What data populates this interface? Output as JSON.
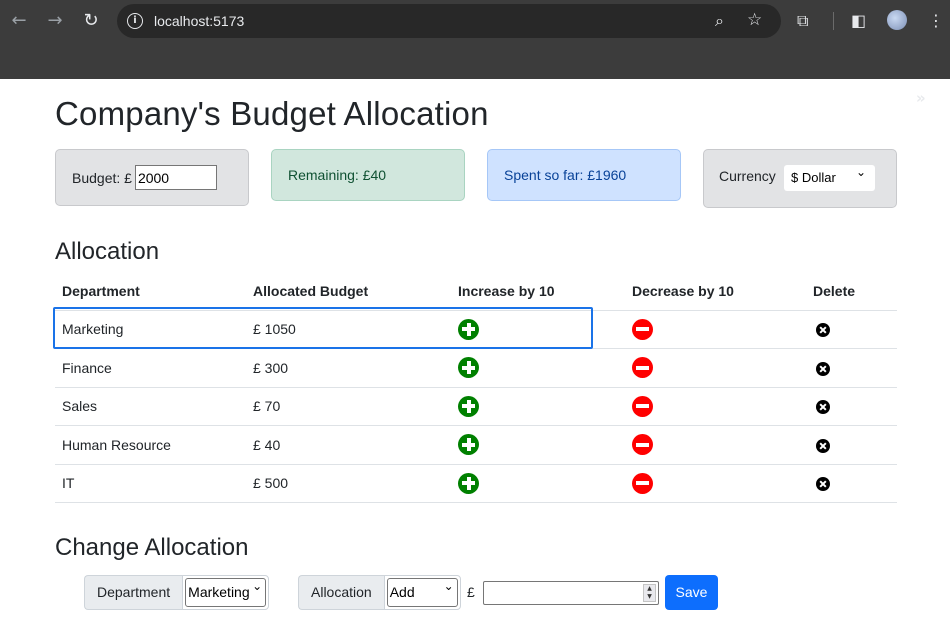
{
  "browser": {
    "url": "localhost:5173",
    "back_icon": "arrow-left-icon",
    "forward_icon": "arrow-right-icon",
    "reload_icon": "reload-icon"
  },
  "header": {
    "title": "Company's Budget Allocation"
  },
  "summary": {
    "budget_label": "Budget: £",
    "budget_value": "2000",
    "remaining": "Remaining: £40",
    "spent": "Spent so far: £1960",
    "currency_label": "Currency",
    "currency_value": "$ Dollar"
  },
  "allocation": {
    "title": "Allocation",
    "columns": [
      "Department",
      "Allocated Budget",
      "Increase by 10",
      "Decrease by 10",
      "Delete"
    ],
    "rows": [
      {
        "department": "Marketing",
        "budget": "£ 1050"
      },
      {
        "department": "Finance",
        "budget": "£ 300"
      },
      {
        "department": "Sales",
        "budget": "£ 70"
      },
      {
        "department": "Human Resource",
        "budget": "£ 40"
      },
      {
        "department": "IT",
        "budget": "£ 500"
      }
    ]
  },
  "change_allocation": {
    "title": "Change Allocation",
    "department_label": "Department",
    "department_value": "Marketing",
    "allocation_label": "Allocation",
    "allocation_value": "Add",
    "currency_symbol": "£",
    "amount_value": "",
    "save_label": "Save"
  },
  "colors": {
    "increase": "#008000",
    "decrease": "#ff0000",
    "save": "#0d6efd"
  }
}
